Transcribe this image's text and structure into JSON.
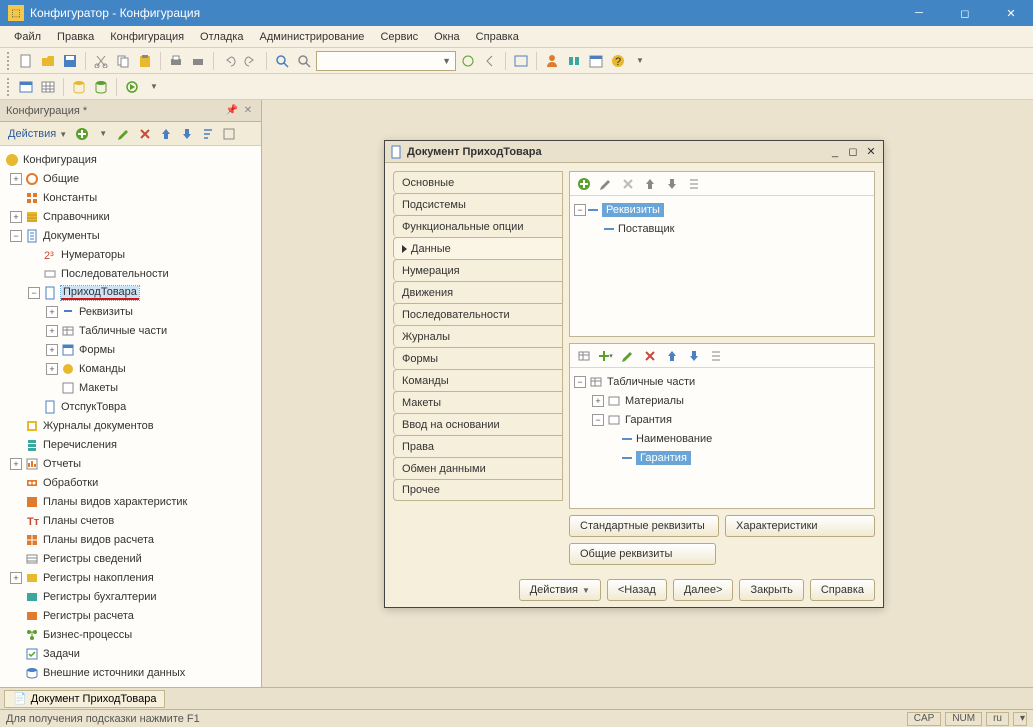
{
  "app": {
    "title": "Конфигуратор - Конфигурация"
  },
  "menu": [
    "Файл",
    "Правка",
    "Конфигурация",
    "Отладка",
    "Администрирование",
    "Сервис",
    "Окна",
    "Справка"
  ],
  "sidebar": {
    "title": "Конфигурация *",
    "actions_label": "Действия",
    "tree": {
      "root": "Конфигурация",
      "items": [
        "Общие",
        "Константы",
        "Справочники",
        "Документы",
        "Нумераторы",
        "Последовательности",
        "ПриходТовара",
        "Реквизиты",
        "Табличные части",
        "Формы",
        "Команды",
        "Макеты",
        "ОтспукТовра",
        "Журналы документов",
        "Перечисления",
        "Отчеты",
        "Обработки",
        "Планы видов характеристик",
        "Планы счетов",
        "Планы видов расчета",
        "Регистры сведений",
        "Регистры накопления",
        "Регистры бухгалтерии",
        "Регистры расчета",
        "Бизнес-процессы",
        "Задачи",
        "Внешние источники данных"
      ]
    }
  },
  "docwin": {
    "title": "Документ ПриходТовара",
    "tabs": [
      "Основные",
      "Подсистемы",
      "Функциональные опции",
      "Данные",
      "Нумерация",
      "Движения",
      "Последовательности",
      "Журналы",
      "Формы",
      "Команды",
      "Макеты",
      "Ввод на основании",
      "Права",
      "Обмен данными",
      "Прочее"
    ],
    "active_tab": "Данные",
    "upper": {
      "root": "Реквизиты",
      "child": "Поставщик"
    },
    "lower": {
      "root": "Табличные части",
      "c1": "Материалы",
      "c2": "Гарантия",
      "c2a": "Наименование",
      "c2b": "Гарантия"
    },
    "buttons": {
      "std_req": "Стандартные реквизиты",
      "characteristics": "Характеристики",
      "common_req": "Общие реквизиты",
      "actions": "Действия",
      "back": "<Назад",
      "next": "Далее>",
      "close": "Закрыть",
      "help": "Справка"
    }
  },
  "taskbar": {
    "task": "Документ ПриходТовара"
  },
  "status": {
    "msg": "Для получения подсказки нажмите F1",
    "cap": "CAP",
    "num": "NUM",
    "lang": "ru"
  }
}
